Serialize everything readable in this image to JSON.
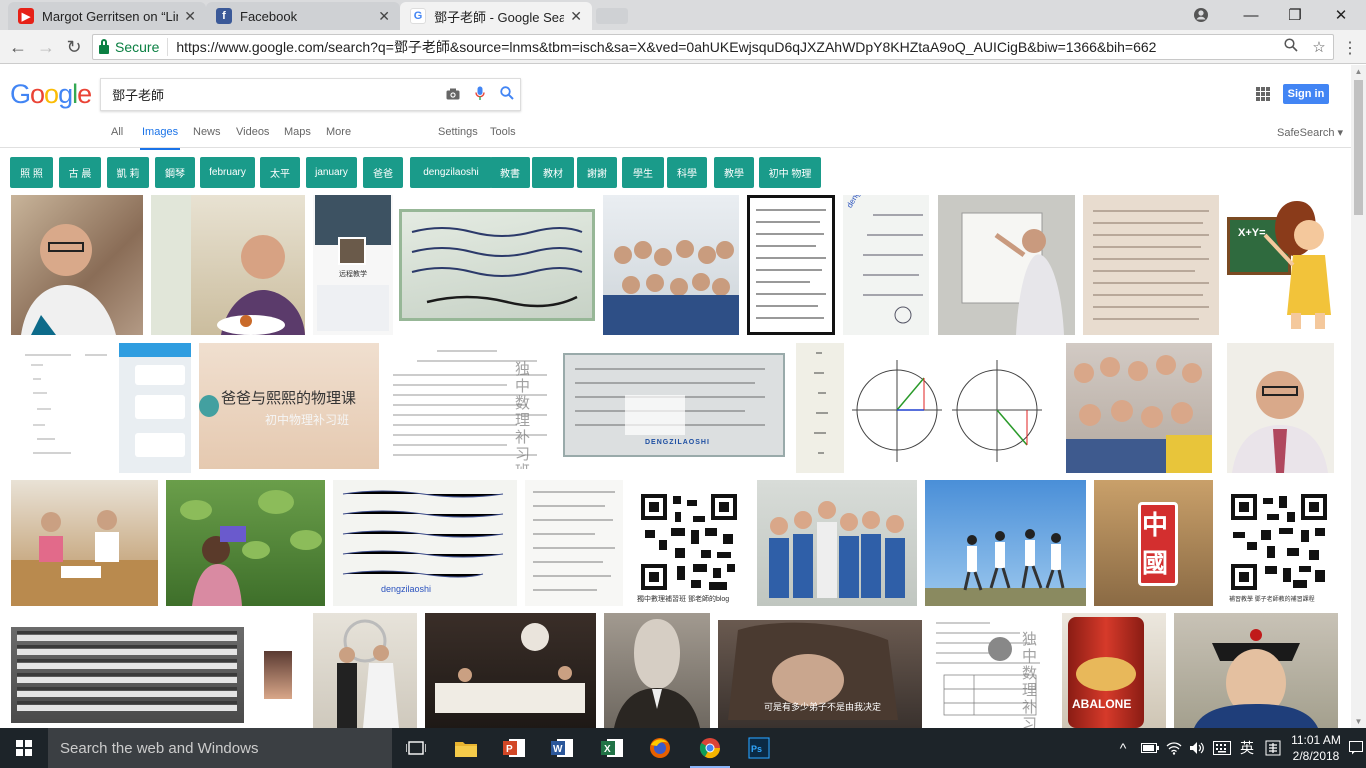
{
  "browser": {
    "tabs": [
      {
        "title": "Margot Gerritsen on “Lin",
        "favicon": "youtube-icon",
        "color": "#e62117"
      },
      {
        "title": "Facebook",
        "favicon": "facebook-icon",
        "color": "#3b5998"
      },
      {
        "title": "鄧子老師 - Google Searc",
        "favicon": "google-icon",
        "color": "#4285f4"
      }
    ],
    "secure_label": "Secure",
    "url": "https://www.google.com/search?q=鄧子老師&source=lnms&tbm=isch&sa=X&ved=0ahUKEwjsquD6qJXZAhWDpY8KHZtaA9oQ_AUICigB&biw=1366&bih=662"
  },
  "google": {
    "logo_letters": [
      "G",
      "o",
      "o",
      "g",
      "l",
      "e"
    ],
    "logo_colors": [
      "#4285f4",
      "#ea4335",
      "#fbbc05",
      "#4285f4",
      "#34a853",
      "#ea4335"
    ],
    "query": "鄧子老師",
    "signin_label": "Sign in",
    "nav": {
      "all": "All",
      "images": "Images",
      "news": "News",
      "videos": "Videos",
      "maps": "Maps",
      "more": "More",
      "settings": "Settings",
      "tools": "Tools",
      "safesearch": "SafeSearch ▾"
    },
    "chips": [
      "照 照",
      "古 晨",
      "凱 莉",
      "鋼琴",
      "february",
      "太平",
      "january",
      "爸爸",
      "dengzilaoshi",
      "教書",
      "教材",
      "謝謝",
      "學生",
      "科學",
      "教學",
      "初中 物理"
    ],
    "image_texts": {
      "slide_title": "爸爸与熙熙的物理课",
      "slide_sub": "初中物理补习班",
      "qr_caption_1": "獨中數理補習班 鄧老師的blog",
      "qr_caption_2": "補習教學 鄧子老師教的補習課程",
      "board_word": "dengzilaoshi",
      "board_word_2": "DENGZILAOSHI",
      "china_char": "中",
      "china_char_2": "國",
      "vertical_text": "独中数理补习班",
      "meme_caption": "可是有多少弟子不是由我决定",
      "abalone": "ABALONE",
      "fb_profile": "远程教学",
      "xy": "X+Y="
    }
  },
  "taskbar": {
    "search_placeholder": "Search the web and Windows",
    "time": "11:01 AM",
    "date": "2/8/2018",
    "ime": "英"
  }
}
